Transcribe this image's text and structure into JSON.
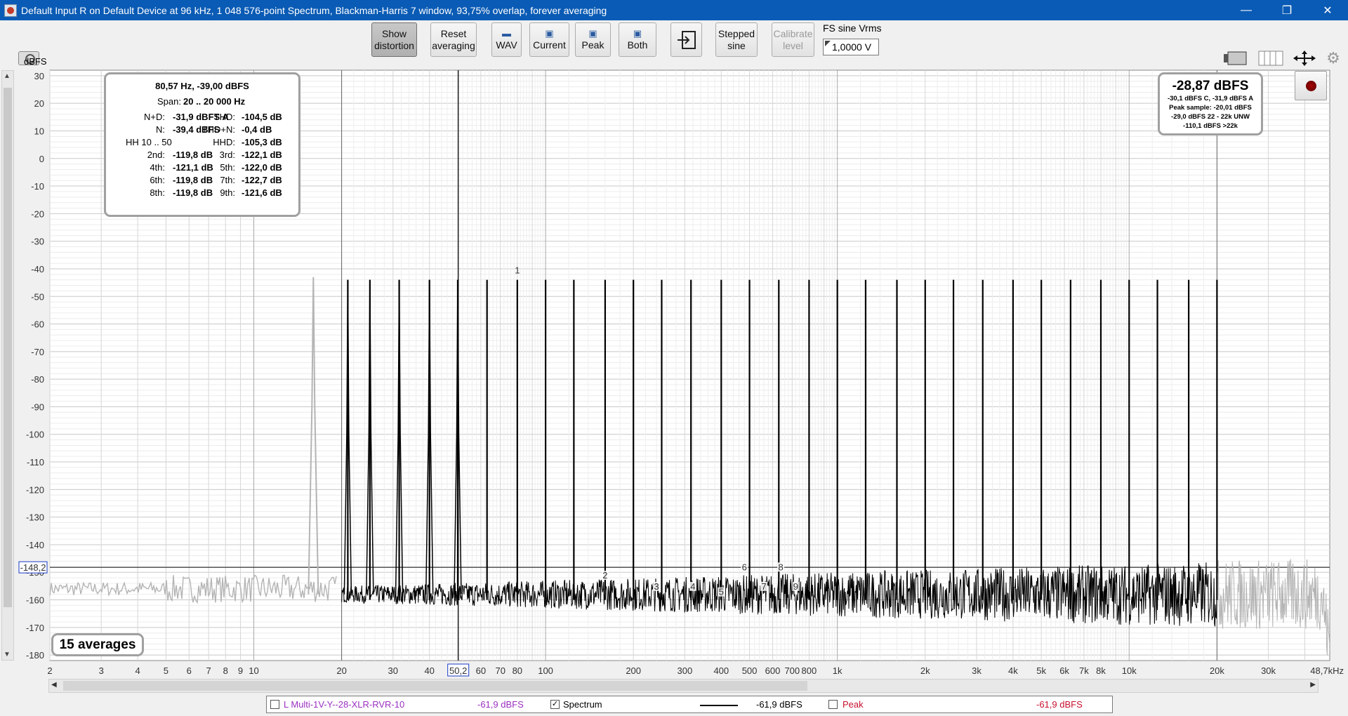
{
  "window": {
    "title": "Default Input R on Default Device at 96 kHz, 1 048 576-point Spectrum, Blackman-Harris 7 window, 93,75% overlap, forever averaging",
    "minimize_glyph": "—",
    "restore_glyph": "❐",
    "close_glyph": "✕"
  },
  "toolbar": {
    "show_distortion": [
      "Show",
      "distortion"
    ],
    "reset_averaging": [
      "Reset",
      "averaging"
    ],
    "wav": "WAV",
    "current": "Current",
    "peak": "Peak",
    "both": "Both",
    "stepped_sine": [
      "Stepped",
      "sine"
    ],
    "calibrate_level": [
      "Calibrate",
      "level"
    ],
    "fs_label": "FS sine Vrms",
    "fs_value": "1,0000 V"
  },
  "icons": {
    "camera": "camera-icon",
    "save": "floppy-disk-icon",
    "folder": "folder-icon",
    "import": "import-icon",
    "layout": "screen-layout-icon",
    "columns": "columns-icon",
    "fit": "fit-arrows-icon",
    "settings": "gear-icon",
    "record": "record-icon"
  },
  "colors": {
    "spectrum": "#000000",
    "out_of_band": "#b4b4b4",
    "peak_trace_text": "#c8102e",
    "left_trace_text": "#9b30c0",
    "cursor_box": "#1a3cc8"
  },
  "yaxis": {
    "unit": "dBFS",
    "cursor_value": "-148,2"
  },
  "info_panel": {
    "cursor": "80,57 Hz, -39,00 dBFS",
    "span_label": "Span:",
    "span_value": "20 .. 20 000 Hz",
    "rows": [
      {
        "l_label": "N+D:",
        "l_value": "-31,9 dBFS A",
        "r_label": "THD:",
        "r_value": "-104,5 dB"
      },
      {
        "l_label": "N:",
        "l_value": "-39,4 dBFS",
        "r_label": "THD+N:",
        "r_value": "-0,4 dB"
      },
      {
        "l_label": "HH 10 .. 50",
        "l_value": "",
        "r_label": "HHD:",
        "r_value": "-105,3 dB"
      },
      {
        "l_label": "2nd:",
        "l_value": "-119,8 dB",
        "r_label": "3rd:",
        "r_value": "-122,1 dB"
      },
      {
        "l_label": "4th:",
        "l_value": "-121,1 dB",
        "r_label": "5th:",
        "r_value": "-122,0 dB"
      },
      {
        "l_label": "6th:",
        "l_value": "-119,8 dB",
        "r_label": "7th:",
        "r_value": "-122,7 dB"
      },
      {
        "l_label": "8th:",
        "l_value": "-119,8 dB",
        "r_label": "9th:",
        "r_value": "-121,6 dB"
      }
    ]
  },
  "level_panel": {
    "main": "-28,87 dBFS",
    "line1": "-30,1 dBFS C, -31,9 dBFS A",
    "line2": "Peak sample: -20,01 dBFS",
    "line3": "-29,0 dBFS 22 - 22k UNW",
    "line4": "-110,1 dBFS >22k"
  },
  "averages_label": "15 averages",
  "legend": {
    "left_trace": "L Multi-1V-Y--28-XLR-RVR-10",
    "left_value": "-61,9 dBFS",
    "spectrum_label": "Spectrum",
    "spectrum_value": "-61,9 dBFS",
    "peak_label": "Peak",
    "peak_value": "-61,9 dBFS",
    "spectrum_checked": "✓"
  },
  "chart_data": {
    "type": "line",
    "xscale": "log",
    "xlim": [
      2,
      48700
    ],
    "ylim": [
      -182,
      32
    ],
    "ylabel": "dBFS",
    "yticks": [
      30,
      20,
      10,
      0,
      -10,
      -20,
      -30,
      -40,
      -50,
      -60,
      -70,
      -80,
      -90,
      -100,
      -110,
      -120,
      -130,
      -140,
      -150,
      -160,
      -170,
      -180
    ],
    "xtick_labels": [
      "2",
      "3",
      "4",
      "5",
      "6",
      "7",
      "8",
      "9",
      "10",
      "20",
      "30",
      "40",
      "50,2",
      "60",
      "70",
      "80",
      "100",
      "200",
      "300",
      "400",
      "500",
      "600",
      "700",
      "800",
      "1k",
      "2k",
      "3k",
      "4k",
      "5k",
      "6k",
      "7k",
      "8k",
      "10k",
      "20k",
      "30k",
      "48,7kHz"
    ],
    "xtick_values": [
      2,
      3,
      4,
      5,
      6,
      7,
      8,
      9,
      10,
      20,
      30,
      40,
      50.2,
      60,
      70,
      80,
      100,
      200,
      300,
      400,
      500,
      600,
      700,
      800,
      1000,
      2000,
      3000,
      4000,
      5000,
      6000,
      7000,
      8000,
      10000,
      20000,
      30000,
      48700
    ],
    "band_low_hz": 20,
    "band_high_hz": 20000,
    "cursor_db": -148.2,
    "noise_floor_db": -158,
    "tone_level_db": -44,
    "out_of_band_tone_hz": 16,
    "tone_frequencies_hz": [
      21,
      25,
      31.5,
      40,
      50,
      63,
      80,
      100,
      125,
      160,
      200,
      250,
      315,
      400,
      500,
      630,
      800,
      1000,
      1250,
      1600,
      2000,
      2500,
      3150,
      4000,
      5000,
      6300,
      8000,
      10000,
      12500,
      16000,
      20000
    ],
    "fundamental_marker": {
      "label": "1",
      "hz": 80
    },
    "harmonic_markers": [
      {
        "label": "2",
        "hz": 160,
        "db": -152
      },
      {
        "label": "3",
        "hz": 240,
        "db": -156
      },
      {
        "label": "4",
        "hz": 320,
        "db": -156
      },
      {
        "label": "5",
        "hz": 400,
        "db": -158
      },
      {
        "label": "6",
        "hz": 480,
        "db": -149
      },
      {
        "label": "7",
        "hz": 560,
        "db": -156
      },
      {
        "label": "8",
        "hz": 640,
        "db": -149
      },
      {
        "label": "9",
        "hz": 720,
        "db": -156
      }
    ]
  }
}
